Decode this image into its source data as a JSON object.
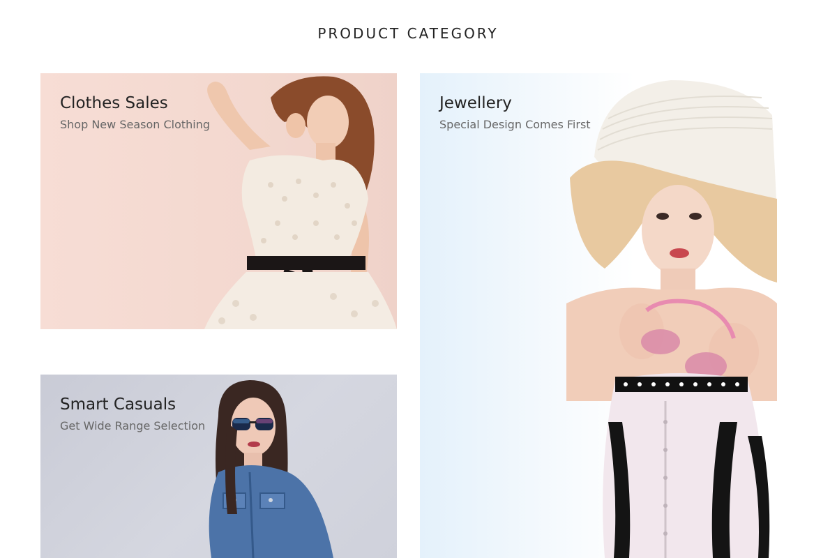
{
  "section": {
    "title": "PRODUCT CATEGORY"
  },
  "categories": [
    {
      "title": "Clothes Sales",
      "subtitle": "Shop New Season Clothing",
      "photo_icon": "woman-lace-dress-photo"
    },
    {
      "title": "Jewellery",
      "subtitle": "Special Design Comes First",
      "photo_icon": "woman-sun-hat-photo"
    },
    {
      "title": "Smart Casuals",
      "subtitle": "Get Wide Range Selection",
      "photo_icon": "woman-denim-sunglasses-photo"
    }
  ],
  "colors": {
    "clothes_bg": "#f5dad2",
    "casuals_bg": "#ced0da",
    "jewellery_bg": "#eef6fc",
    "title_text": "#222222",
    "subtitle_text": "#666666"
  }
}
